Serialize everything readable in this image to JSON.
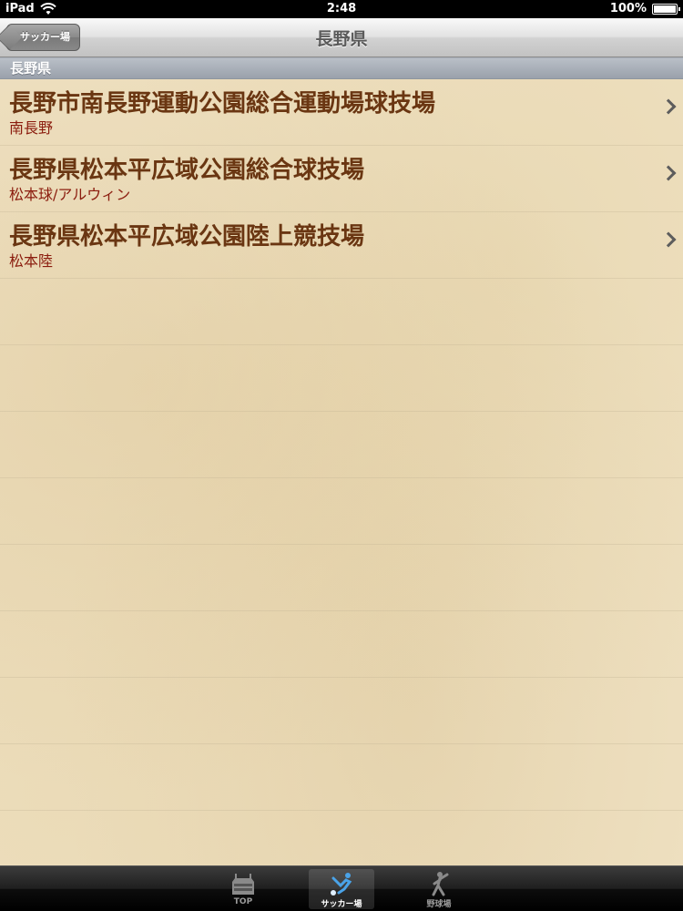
{
  "statusbar": {
    "device": "iPad",
    "time": "2:48",
    "battery": "100%"
  },
  "navbar": {
    "back_label": "サッカー場",
    "title": "長野県"
  },
  "section": {
    "header": "長野県"
  },
  "rows": [
    {
      "title": "長野市南長野運動公園総合運動場球技場",
      "subtitle": "南長野"
    },
    {
      "title": "長野県松本平広域公園総合球技場",
      "subtitle": "松本球/アルウィン"
    },
    {
      "title": "長野県松本平広域公園陸上競技場",
      "subtitle": "松本陸"
    }
  ],
  "tabs": [
    {
      "label": "TOP",
      "icon": "stadium-icon",
      "selected": false
    },
    {
      "label": "サッカー場",
      "icon": "soccer-player-icon",
      "selected": true
    },
    {
      "label": "野球場",
      "icon": "baseball-player-icon",
      "selected": false
    }
  ],
  "colors": {
    "accent": "#6a3612",
    "subtitle": "#8b1c0e",
    "selected_tab_icon": "#4aa3e8"
  }
}
